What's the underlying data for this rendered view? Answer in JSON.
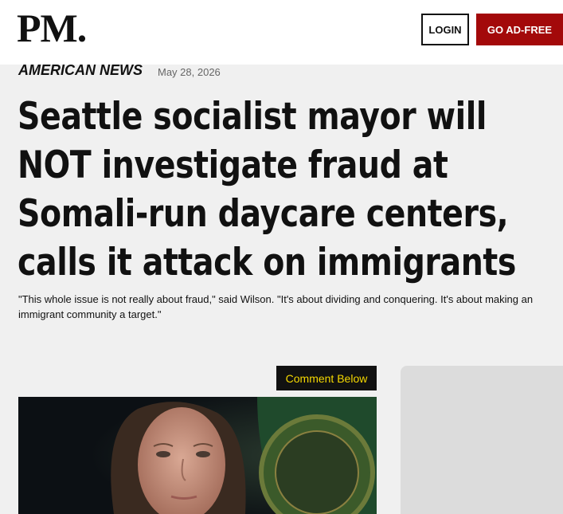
{
  "header": {
    "logo_text": "PM.",
    "login_label": "LOGIN",
    "adfree_label": "GO AD-FREE"
  },
  "article": {
    "category": "AMERICAN NEWS",
    "date": "May 28, 2026",
    "headline": "Seattle socialist mayor will NOT investigate fraud at Somali-run daycare centers, calls it attack on immigrants",
    "subtitle": "\"This whole issue is not really about fraud,\" said Wilson. \"It's about dividing and conquering. It's about making an immigrant community a target.\"",
    "comment_label": "Comment Below"
  },
  "colors": {
    "brand_red": "#a3090a",
    "comment_text": "#f5d800",
    "page_bg": "#f0f0f0"
  }
}
